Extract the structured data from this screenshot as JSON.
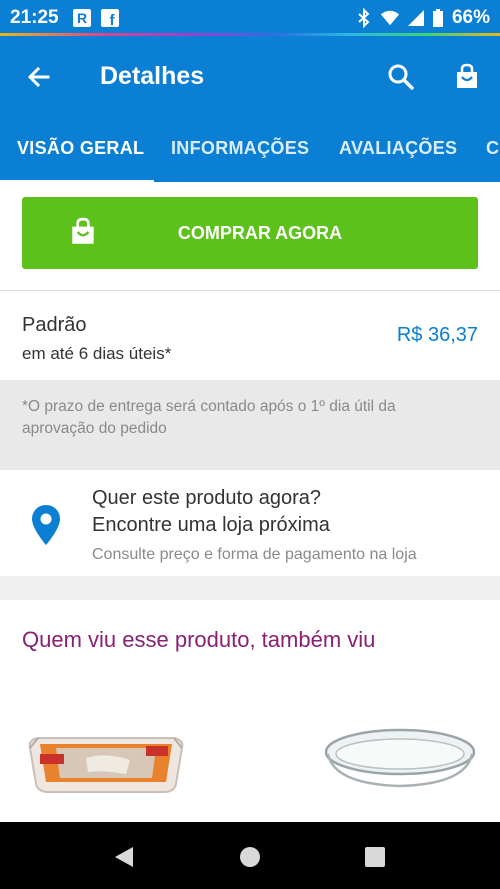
{
  "status_bar": {
    "time": "21:25",
    "battery": "66%",
    "icons": [
      "r-app-icon",
      "facebook-icon",
      "bluetooth-icon",
      "wifi-icon",
      "signal-icon",
      "battery-icon"
    ]
  },
  "header": {
    "title": "Detalhes",
    "back_icon": "arrow-back-icon",
    "search_icon": "search-icon",
    "cart_icon": "shopping-bag-icon",
    "color": "#0a7fd4"
  },
  "tabs": [
    {
      "label": "VISÃO GERAL",
      "active": true
    },
    {
      "label": "INFORMAÇÕES",
      "active": false
    },
    {
      "label": "AVALIAÇÕES",
      "active": false
    },
    {
      "label": "C",
      "active": false
    }
  ],
  "buy": {
    "label": "COMPRAR AGORA",
    "icon": "shopping-bag-icon",
    "color": "#5cc11a"
  },
  "shipping": {
    "name": "Padrão",
    "time": "em até 6 dias úteis*",
    "price": "R$ 36,37",
    "note": "*O prazo de entrega será contado após o 1º dia útil da aprovação do pedido"
  },
  "store": {
    "line1": "Quer este produto agora?",
    "line2": "Encontre uma loja próxima",
    "subtitle": "Consulte preço e forma de pagamento na loja",
    "icon": "location-pin-icon"
  },
  "recommendations": {
    "title": "Quem viu esse produto, também viu",
    "items": [
      {
        "image": "glass-baking-dish-image"
      },
      {
        "image": "glass-oval-dish-image"
      }
    ]
  },
  "nav": {
    "icons": [
      "back-triangle-icon",
      "home-circle-icon",
      "recents-square-icon"
    ]
  }
}
